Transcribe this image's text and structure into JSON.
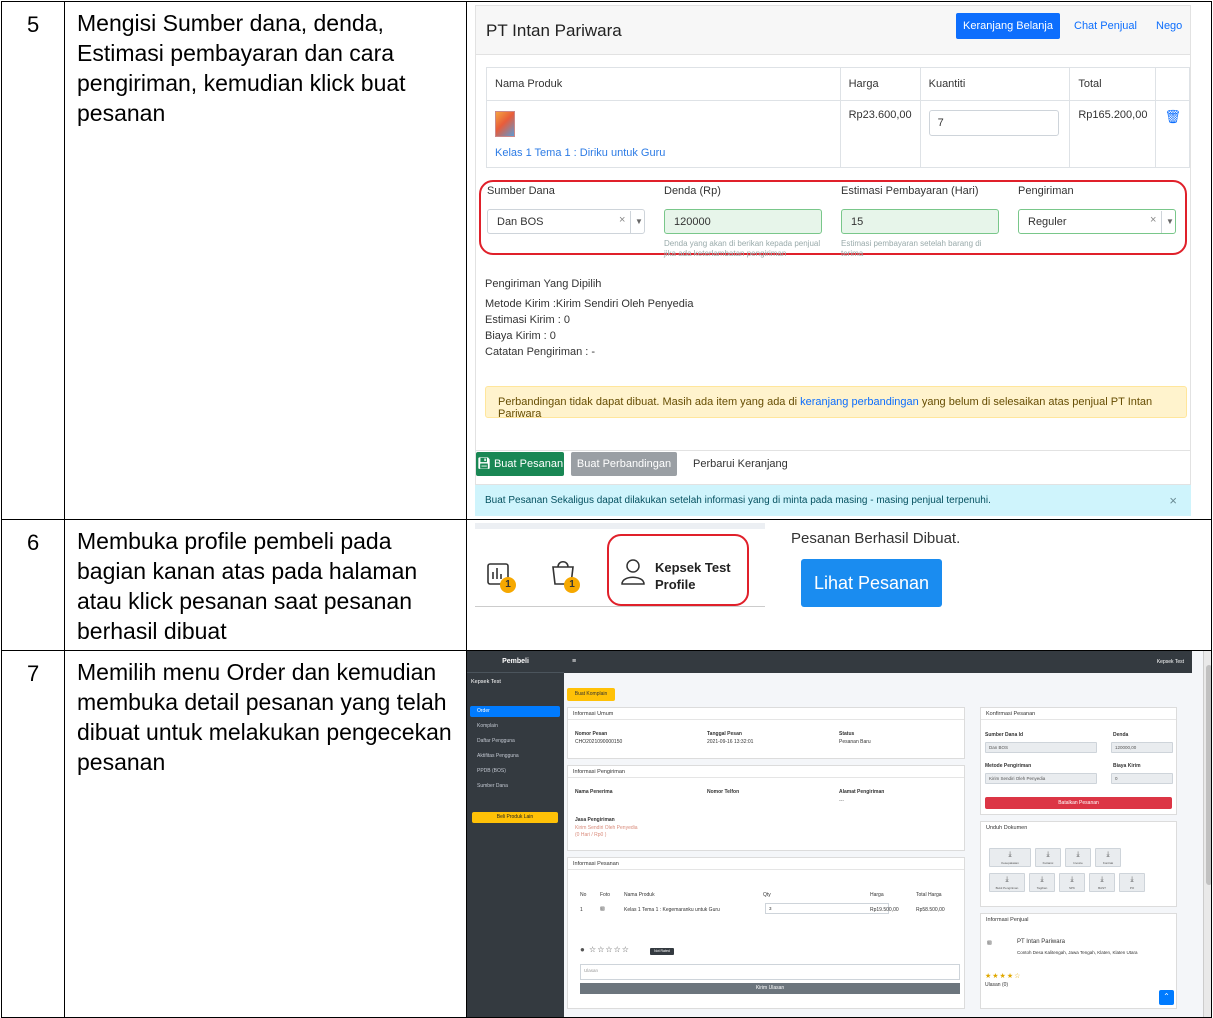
{
  "rows": [
    {
      "number": "5",
      "description": "Mengisi Sumber dana, denda, Estimasi pembayaran dan cara pengiriman, kemudian klick buat pesanan"
    },
    {
      "number": "6",
      "description": "Membuka profile pembeli pada bagian kanan atas pada halaman atau klick pesanan saat pesanan berhasil dibuat"
    },
    {
      "number": "7",
      "description": "Memilih menu Order dan kemudian membuka detail pesanan yang telah dibuat untuk melakukan pengecekan pesanan"
    }
  ],
  "step5": {
    "seller_title": "PT Intan Pariwara",
    "cart_button": "Keranjang Belanja",
    "chat_link": "Chat Penjual",
    "nego_link": "Nego",
    "columns": [
      "Nama Produk",
      "Harga",
      "Kuantiti",
      "Total"
    ],
    "product": {
      "name": "Kelas 1 Tema 1 : Diriku untuk Guru",
      "price": "Rp23.600,00",
      "qty": "7",
      "total": "Rp165.200,00"
    },
    "fields": {
      "sumber_label": "Sumber Dana",
      "sumber_value": "Dan BOS",
      "denda_label": "Denda (Rp)",
      "denda_value": "120000",
      "denda_help": "Denda yang akan di berikan kepada penjual jika ada keterlambatan pengiriman",
      "estimasi_label": "Estimasi Pembayaran (Hari)",
      "estimasi_value": "15",
      "estimasi_help": "Estimasi pembayaran setelah barang di terima",
      "pengiriman_label": "Pengiriman",
      "pengiriman_value": "Reguler"
    },
    "shipping": {
      "title": "Pengiriman Yang Dipilih",
      "method": "Metode Kirim :Kirim Sendiri Oleh Penyedia",
      "estimate": "Estimasi Kirim : 0",
      "cost": "Biaya Kirim : 0",
      "note": "Catatan Pengiriman : -"
    },
    "warning_pre": "Perbandingan tidak dapat dibuat. Masih ada item yang ada di ",
    "warning_link": "keranjang perbandingan",
    "warning_post": " yang belum di selesaikan atas penjual PT Intan Pariwara",
    "btn_buat_pesanan": "Buat Pesanan",
    "btn_buat_perbandingan": "Buat Perbandingan",
    "btn_perbarui": "Perbarui Keranjang",
    "info_text": "Buat Pesanan Sekaligus dapat dilakukan setelah informasi yang di minta pada masing - masing penjual terpenuhi.",
    "info_close": "×"
  },
  "step6": {
    "badge_chart": "1",
    "badge_bag": "1",
    "profile_name": "Kepsek Test",
    "profile_link": "Profile",
    "success_text": "Pesanan Berhasil Dibuat.",
    "view_button": "Lihat Pesanan"
  },
  "step7": {
    "brand": "Pembeli",
    "user": "Kepsek Test",
    "nav": [
      "Order",
      "Komplain",
      "Daftar Pengguna",
      "Aktifitas Pengguna",
      "PPDB (BOS)",
      "Sumber Dana"
    ],
    "nav_button": "Beli Produk Lain",
    "top_user": "Kepsek Test",
    "buat_komplain": "Buat Komplain",
    "info_umum": {
      "title": "Informasi Umum",
      "nomor_label": "Nomor Pesan",
      "nomor_value": "CHO2021090000150",
      "tanggal_label": "Tanggal Pesan",
      "tanggal_value": "2021-09-16 13:32:01",
      "status_label": "Status",
      "status_value": "Pesanan Baru"
    },
    "info_pengiriman": {
      "title": "Informasi Pengiriman",
      "penerima_label": "Nama Penerima",
      "telfon_label": "Nomor Telfon",
      "alamat_label": "Alamat Pengiriman",
      "alamat_value": "---",
      "jasa_label": "Jasa Pengiriman",
      "jasa_value": "Kirim Sendiri Oleh Penyedia",
      "jasa_sub": "(0 Hari / Rp0 )"
    },
    "info_pesanan": {
      "title": "Informasi Pesanan",
      "columns": [
        "No",
        "Foto",
        "Nama Produk",
        "Qty",
        "Harga",
        "Total Harga"
      ],
      "row": {
        "no": "1",
        "name": "Kelas 1 Tema 1 : Kegemaranku untuk Guru",
        "qty": "3",
        "price": "Rp19.500,00",
        "total": "Rp58.500,00"
      },
      "rating_badge": "Not Rated",
      "ulasan_placeholder": "Ulasan",
      "kirim_ulasan": "Kirim Ulasan"
    },
    "konfirmasi": {
      "title": "Konfirmasi Pesanan",
      "sumber_label": "Sumber Dana Id",
      "sumber_value": "Dan BOS",
      "denda_label": "Denda",
      "denda_value": "120000,00",
      "metode_label": "Metode Pengiriman",
      "metode_value": "Kirim Sendiri Oleh Penyedia",
      "biaya_label": "Biaya Kirim",
      "biaya_value": "0",
      "batalkan": "Batalkan Pesanan"
    },
    "unduh": {
      "title": "Unduh Dokumen",
      "buttons_row1": [
        "Kesepakatan",
        "Kuitansi",
        "Invoice",
        "Kontrak"
      ],
      "buttons_row2": [
        "Bukti Pengiriman",
        "Tagihan",
        "SPK",
        "BAST",
        "PO"
      ]
    },
    "penjual": {
      "title": "Informasi Penjual",
      "name": "PT Intan Pariwara",
      "address": "Contoh Desa Kalitengah, Jawa Tengah, Klaten, Klaten Utara",
      "ulasan": "Ulasan (0)"
    }
  }
}
